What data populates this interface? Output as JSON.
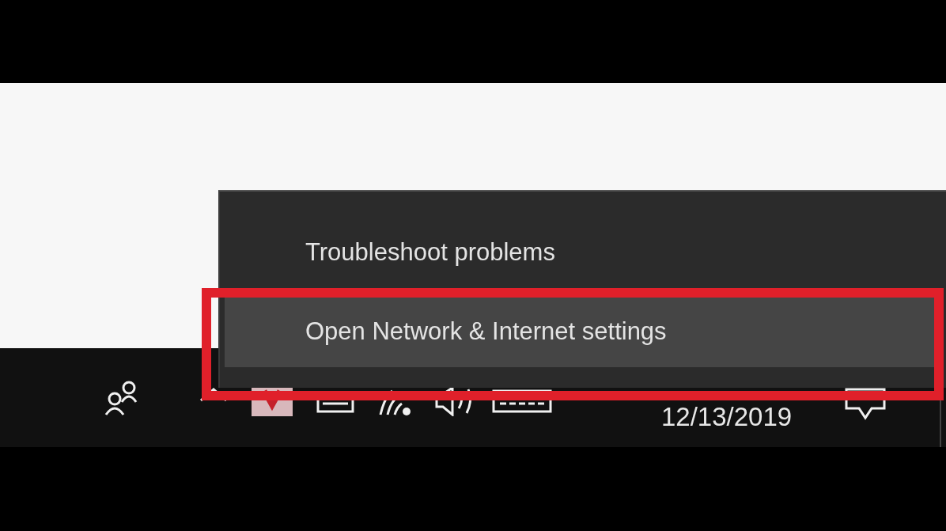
{
  "context_menu": {
    "items": [
      {
        "label": "Troubleshoot problems",
        "selected": false
      },
      {
        "label": "Open Network & Internet settings",
        "selected": true
      }
    ]
  },
  "highlight_frame": {
    "color": "#e0202a"
  },
  "taskbar": {
    "date": "12/13/2019"
  }
}
